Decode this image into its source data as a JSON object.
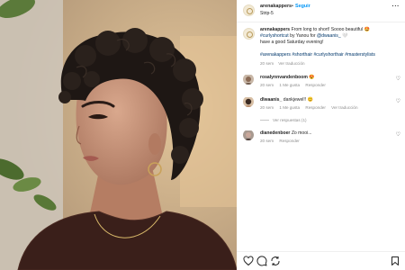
{
  "post": {
    "username": "arenakappers",
    "separator": "•",
    "follow_label": "Seguir",
    "subtitle": "Strip-5",
    "more_icon": "more-icon"
  },
  "caption": {
    "username": "arenakappers",
    "text_1": "From long to short! Soooo beautiful 🤩",
    "hashtag_1": "#curlyshortcut",
    "text_2": " by Yanou for ",
    "mention": "@dwaanis_",
    "text_3": " 🤍",
    "text_4": "have a good Saturday evening!",
    "hashtags": "#arenakappers #shorthair #curlyshorthair #masterstylists",
    "time": "20 sem",
    "translate": "Ver traducción"
  },
  "comments": [
    {
      "username": "rosalynnvandenboom",
      "text": " 😍",
      "time": "20 sem",
      "likes": "1 Me gusta",
      "reply": "Responder"
    },
    {
      "username": "dlwaanis_",
      "text": " dankjewel!! 😊",
      "time": "20 sem",
      "likes": "1 Me gusta",
      "reply": "Responder",
      "translate": "Ver traducción"
    },
    {
      "username": "dianedenboer",
      "text": " Zo mooi...",
      "time": "20 sem",
      "reply": "Responder"
    }
  ],
  "view_replies": "Ver respuestas (1)",
  "colors": {
    "link": "#0095f6",
    "hashtag": "#00376b",
    "meta": "#8e8e8e"
  },
  "icons": [
    "heart-icon",
    "comment-icon",
    "share-icon",
    "save-icon"
  ]
}
